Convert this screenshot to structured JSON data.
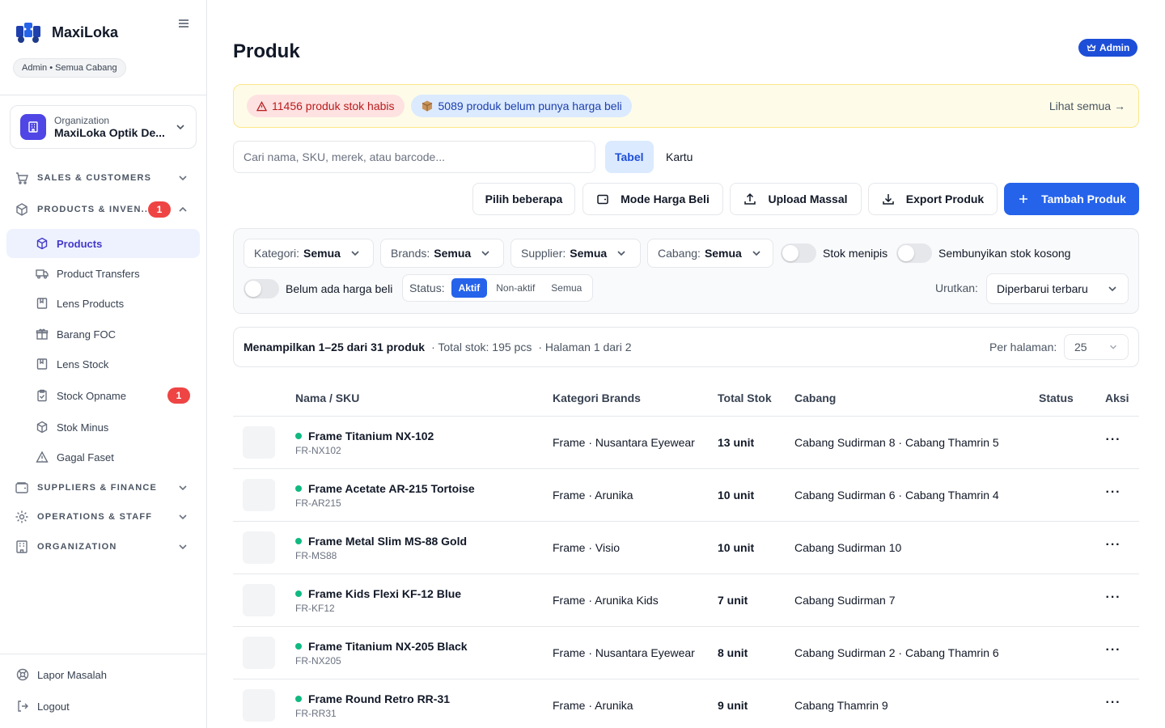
{
  "app": {
    "name": "MaxiLoka",
    "role_chip": "Admin • Semua Cabang"
  },
  "org": {
    "label": "Organization",
    "name": "MaxiLoka Optik De..."
  },
  "sidebar": {
    "sections": [
      {
        "label": "SALES & CUSTOMERS"
      },
      {
        "label": "PRODUCTS & INVEN...",
        "badge": "1"
      },
      {
        "label": "SUPPLIERS & FINANCE"
      },
      {
        "label": "OPERATIONS & STAFF"
      },
      {
        "label": "ORGANIZATION"
      }
    ],
    "items": [
      {
        "label": "Products"
      },
      {
        "label": "Product Transfers"
      },
      {
        "label": "Lens Products"
      },
      {
        "label": "Barang FOC"
      },
      {
        "label": "Lens Stock"
      },
      {
        "label": "Stock Opname",
        "badge": "1"
      },
      {
        "label": "Stok Minus"
      },
      {
        "label": "Gagal Faset"
      }
    ],
    "footer": {
      "report": "Lapor Masalah",
      "logout": "Logout"
    }
  },
  "header": {
    "title": "Produk",
    "admin_badge": "Admin"
  },
  "alerts": {
    "out_of_stock": "11456 produk stok habis",
    "no_buy_price": "5089 produk belum punya harga beli",
    "see_all": "Lihat semua →"
  },
  "search": {
    "placeholder": "Cari nama, SKU, merek, atau barcode...",
    "value": ""
  },
  "view_tabs": {
    "table": "Tabel",
    "card": "Kartu"
  },
  "actions": {
    "select_multiple": "Pilih beberapa",
    "buy_price_mode": "Mode Harga Beli",
    "bulk_upload": "Upload Massal",
    "export": "Export Produk",
    "add": "Tambah Produk"
  },
  "filters": {
    "category": {
      "label": "Kategori:",
      "value": "Semua"
    },
    "brands": {
      "label": "Brands:",
      "value": "Semua"
    },
    "supplier": {
      "label": "Supplier:",
      "value": "Semua"
    },
    "branch": {
      "label": "Cabang:",
      "value": "Semua"
    },
    "toggles": {
      "low_stock": "Stok menipis",
      "hide_empty": "Sembunyikan stok kosong",
      "no_buy_price": "Belum ada harga beli"
    },
    "status": {
      "label": "Status:",
      "options": [
        "Aktif",
        "Non-aktif",
        "Semua"
      ],
      "selected": "Aktif"
    },
    "sort": {
      "label": "Urutkan:",
      "value": "Diperbarui terbaru"
    }
  },
  "summary": {
    "showing": "Menampilkan 1–25 dari 31 produk",
    "total_stock": "· Total stok: 195 pcs",
    "page": "· Halaman 1 dari 2",
    "per_page_label": "Per halaman:",
    "per_page": "25"
  },
  "table": {
    "headers": {
      "name": "Nama / SKU",
      "category": "Kategori Brands",
      "stock": "Total Stok",
      "branch": "Cabang",
      "status": "Status",
      "action": "Aksi"
    },
    "rows": [
      {
        "name": "Frame Titanium NX-102",
        "sku": "FR-NX102",
        "category": "Frame · Nusantara Eyewear",
        "stock": "13 unit",
        "branch": "Cabang Sudirman 8 · Cabang Thamrin 5"
      },
      {
        "name": "Frame Acetate AR-215 Tortoise",
        "sku": "FR-AR215",
        "category": "Frame · Arunika",
        "stock": "10 unit",
        "branch": "Cabang Sudirman 6 · Cabang Thamrin 4"
      },
      {
        "name": "Frame Metal Slim MS-88 Gold",
        "sku": "FR-MS88",
        "category": "Frame · Visio",
        "stock": "10 unit",
        "branch": "Cabang Sudirman 10"
      },
      {
        "name": "Frame Kids Flexi KF-12 Blue",
        "sku": "FR-KF12",
        "category": "Frame · Arunika Kids",
        "stock": "7 unit",
        "branch": "Cabang Sudirman 7"
      },
      {
        "name": "Frame Titanium NX-205 Black",
        "sku": "FR-NX205",
        "category": "Frame · Nusantara Eyewear",
        "stock": "8 unit",
        "branch": "Cabang Sudirman 2 · Cabang Thamrin 6"
      },
      {
        "name": "Frame Round Retro RR-31",
        "sku": "FR-RR31",
        "category": "Frame · Arunika",
        "stock": "9 unit",
        "branch": "Cabang Thamrin 9"
      }
    ],
    "action_glyph": "···"
  },
  "colors": {
    "primary": "#2563eb",
    "active_dot": "#10b981",
    "danger": "#ef4444",
    "brand": "#4f46e5"
  }
}
